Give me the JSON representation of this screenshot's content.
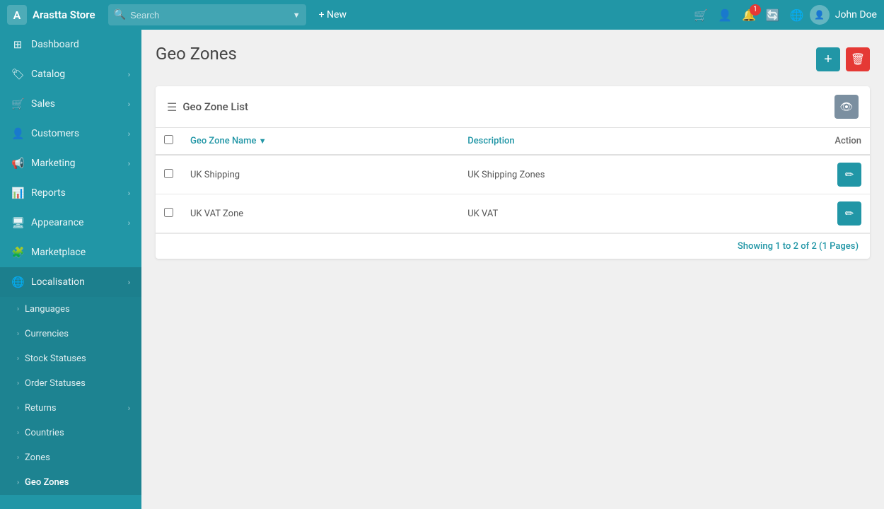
{
  "brand": {
    "icon": "A",
    "name": "Arastta Store"
  },
  "topbar": {
    "search_placeholder": "Search",
    "new_label": "+ New",
    "user_name": "John Doe",
    "notification_count": "1"
  },
  "sidebar": {
    "items": [
      {
        "id": "dashboard",
        "label": "Dashboard",
        "icon": "⊞",
        "has_arrow": false
      },
      {
        "id": "catalog",
        "label": "Catalog",
        "icon": "🏷",
        "has_arrow": true
      },
      {
        "id": "sales",
        "label": "Sales",
        "icon": "🛒",
        "has_arrow": true
      },
      {
        "id": "customers",
        "label": "Customers",
        "icon": "👤",
        "has_arrow": true
      },
      {
        "id": "marketing",
        "label": "Marketing",
        "icon": "📢",
        "has_arrow": true
      },
      {
        "id": "reports",
        "label": "Reports",
        "icon": "📊",
        "has_arrow": true
      },
      {
        "id": "appearance",
        "label": "Appearance",
        "icon": "🖥",
        "has_arrow": true
      },
      {
        "id": "marketplace",
        "label": "Marketplace",
        "icon": "🧩",
        "has_arrow": false
      },
      {
        "id": "localisation",
        "label": "Localisation",
        "icon": "🌐",
        "has_arrow": true
      }
    ],
    "sub_items": [
      {
        "id": "languages",
        "label": "Languages"
      },
      {
        "id": "currencies",
        "label": "Currencies"
      },
      {
        "id": "stock-statuses",
        "label": "Stock Statuses"
      },
      {
        "id": "order-statuses",
        "label": "Order Statuses"
      },
      {
        "id": "returns",
        "label": "Returns",
        "has_arrow": true
      },
      {
        "id": "countries",
        "label": "Countries"
      },
      {
        "id": "zones",
        "label": "Zones"
      },
      {
        "id": "geo-zones",
        "label": "Geo Zones"
      }
    ]
  },
  "page": {
    "title": "Geo Zones",
    "add_button_label": "+",
    "delete_button_label": "🗑"
  },
  "card": {
    "title": "Geo Zone List"
  },
  "table": {
    "columns": [
      {
        "id": "name",
        "label": "Geo Zone Name",
        "sortable": true
      },
      {
        "id": "description",
        "label": "Description"
      },
      {
        "id": "action",
        "label": "Action"
      }
    ],
    "rows": [
      {
        "id": 1,
        "name": "UK Shipping",
        "description": "UK Shipping Zones"
      },
      {
        "id": 2,
        "name": "UK VAT Zone",
        "description": "UK VAT"
      }
    ]
  },
  "pagination": {
    "showing_prefix": "Showing ",
    "from": "1",
    "to_prefix": " to ",
    "to": "2",
    "of_prefix": " of ",
    "total": "2",
    "pages_prefix": " (",
    "pages": "1",
    "pages_suffix": " Pages)"
  }
}
